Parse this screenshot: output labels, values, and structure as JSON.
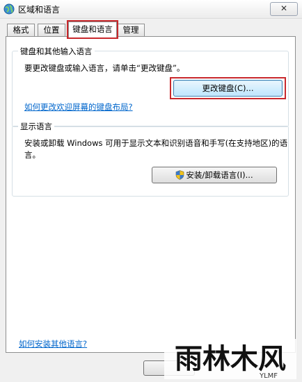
{
  "window": {
    "title": "区域和语言",
    "close_label": "✕"
  },
  "tabs": [
    {
      "label": "格式"
    },
    {
      "label": "位置"
    },
    {
      "label": "键盘和语言",
      "active": true
    },
    {
      "label": "管理"
    }
  ],
  "keyboard_group": {
    "title": "键盘和其他输入语言",
    "description": "要更改键盘或输入语言，请单击“更改键盘”。",
    "button_label": "更改键盘(C)...",
    "help_link": "如何更改欢迎屏幕的键盘布局?"
  },
  "display_group": {
    "title": "显示语言",
    "description_line1": "安装或卸载 Windows 可用于显示文本和识别语音和手写(在支持地区)的语",
    "description_line2": "言。",
    "button_label": "安装/卸载语言(I)..."
  },
  "footer": {
    "install_link": "如何安装其他语言?"
  },
  "watermark": {
    "text": "雨林木风",
    "subtext": "YLMF"
  },
  "colors": {
    "highlight": "#c8282c",
    "link": "#0066cc"
  }
}
